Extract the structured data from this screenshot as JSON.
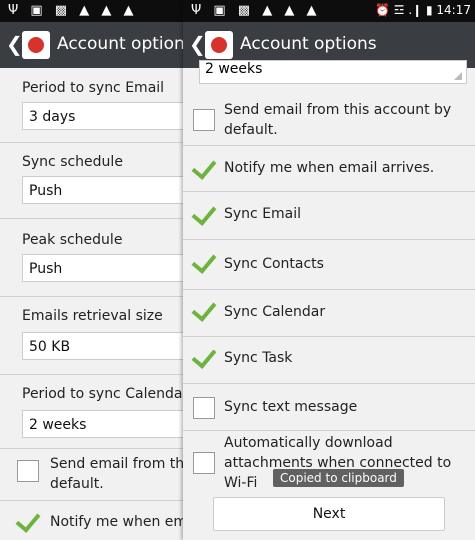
{
  "left_screen": {
    "status_icons": "Ψ ▣ ▩ ▲ ▲ ▲",
    "title": "Account options",
    "fields": [
      {
        "label": "Period to sync Email",
        "value": "3 days"
      },
      {
        "label": "Sync schedule",
        "value": "Push"
      },
      {
        "label": "Peak schedule",
        "value": "Push"
      },
      {
        "label": "Emails retrieval size",
        "value": "50 KB"
      },
      {
        "label": "Period to sync Calendar",
        "value": "2 weeks"
      }
    ],
    "send_email_line1": "Send email from thi",
    "send_email_line2": "default.",
    "notify_text": "Notify me when em"
  },
  "right_screen": {
    "status_icons": "Ψ ▣ ▩ ▲ ▲ ▲",
    "status_right": "⏰ ☲ .❙ ▮ 14:17",
    "title": "Account options",
    "top_field_value": "2 weeks",
    "options": [
      {
        "label": "Send email from this account by default.",
        "checked": false
      },
      {
        "label": "Notify me when email arrives.",
        "checked": true
      },
      {
        "label": "Sync Email",
        "checked": true
      },
      {
        "label": "Sync Contacts",
        "checked": true
      },
      {
        "label": "Sync Calendar",
        "checked": true
      },
      {
        "label": "Sync Task",
        "checked": true
      },
      {
        "label": "Sync text message",
        "checked": false
      },
      {
        "label": "Automatically download attachments when connected to Wi-Fi",
        "checked": false
      }
    ],
    "toast": "Copied to clipboard",
    "next_label": "Next"
  }
}
